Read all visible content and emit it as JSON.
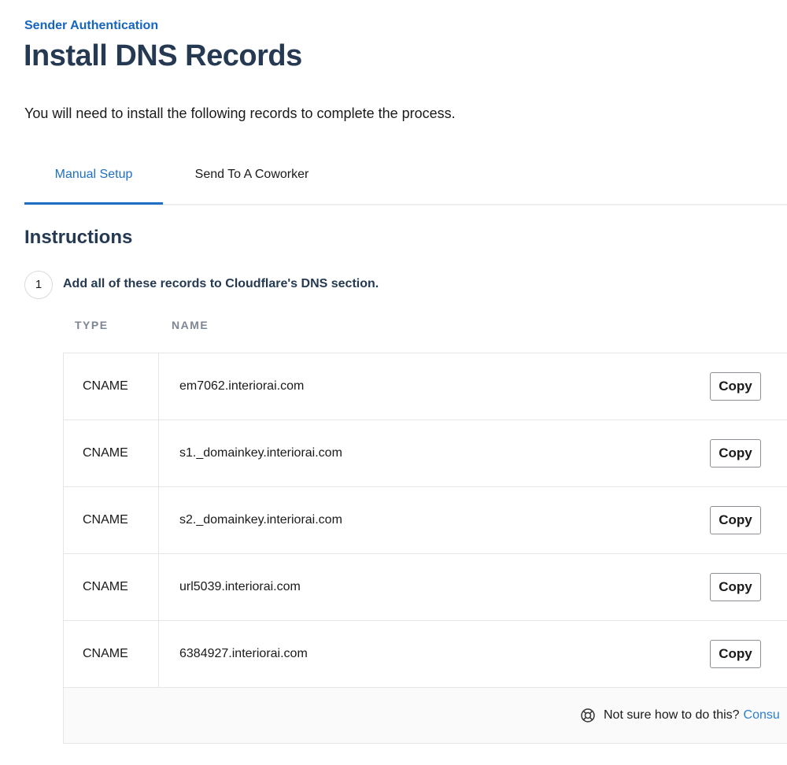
{
  "header": {
    "eyebrow": "Sender Authentication",
    "title": "Install DNS Records",
    "intro": "You will need to install the following records to complete the process."
  },
  "tabs": [
    {
      "label": "Manual Setup",
      "active": true
    },
    {
      "label": "Send To A Coworker",
      "active": false
    }
  ],
  "instructions": {
    "heading": "Instructions",
    "step_number": "1",
    "step_text": "Add all of these records to Cloudflare's DNS section.",
    "columns": [
      "TYPE",
      "NAME"
    ],
    "records": [
      {
        "type": "CNAME",
        "name": "em7062.interiorai.com",
        "action": "Copy"
      },
      {
        "type": "CNAME",
        "name": "s1._domainkey.interiorai.com",
        "action": "Copy"
      },
      {
        "type": "CNAME",
        "name": "s2._domainkey.interiorai.com",
        "action": "Copy"
      },
      {
        "type": "CNAME",
        "name": "url5039.interiorai.com",
        "action": "Copy"
      },
      {
        "type": "CNAME",
        "name": "6384927.interiorai.com",
        "action": "Copy"
      }
    ],
    "help": {
      "icon": "lifebuoy-icon",
      "text": "Not sure how to do this?",
      "link": "Consu"
    }
  },
  "colors": {
    "accent": "#1f6fc5",
    "heading": "#253a52"
  }
}
